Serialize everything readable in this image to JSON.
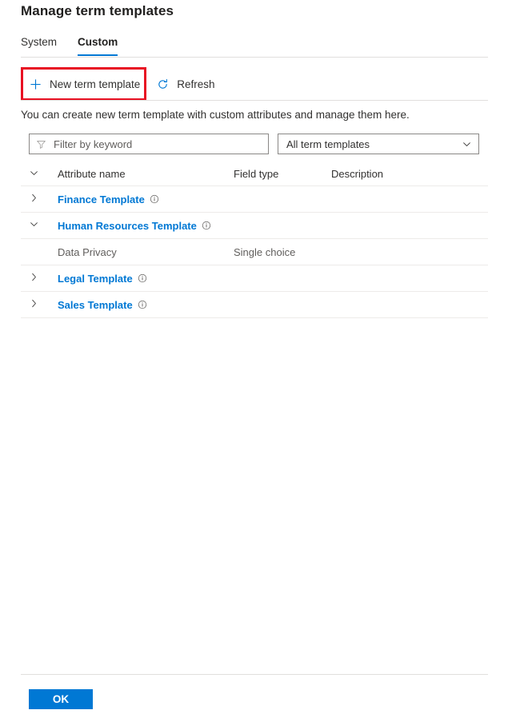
{
  "page": {
    "title": "Manage term templates"
  },
  "tabs": [
    {
      "label": "System",
      "active": false
    },
    {
      "label": "Custom",
      "active": true
    }
  ],
  "toolbar": {
    "new_template_label": "New term template",
    "new_template_icon": "plus-icon",
    "refresh_label": "Refresh",
    "refresh_icon": "refresh-icon",
    "highlight_color": "#e81123"
  },
  "description": "You can create new term template with custom attributes and manage them here.",
  "filters": {
    "search_placeholder": "Filter by keyword",
    "search_value": "",
    "search_icon": "filter-funnel-icon",
    "template_select_value": "All term templates",
    "template_select_icon": "chevron-down-icon"
  },
  "table": {
    "columns": {
      "toggle": "",
      "attribute_name": "Attribute name",
      "field_type": "Field type",
      "description": "Description"
    },
    "header_toggle_icon": "chevron-down-icon",
    "rows": [
      {
        "kind": "template",
        "toggle_icon": "chevron-right-icon",
        "name": "Finance Template",
        "info_icon": "info-icon",
        "field_type": "",
        "description": ""
      },
      {
        "kind": "template",
        "toggle_icon": "chevron-down-icon",
        "name": "Human Resources Template",
        "info_icon": "info-icon",
        "field_type": "",
        "description": ""
      },
      {
        "kind": "attribute",
        "toggle_icon": "",
        "name": "Data Privacy",
        "info_icon": "",
        "field_type": "Single choice",
        "description": ""
      },
      {
        "kind": "template",
        "toggle_icon": "chevron-right-icon",
        "name": "Legal Template",
        "info_icon": "info-icon",
        "field_type": "",
        "description": ""
      },
      {
        "kind": "template",
        "toggle_icon": "chevron-right-icon",
        "name": "Sales Template",
        "info_icon": "info-icon",
        "field_type": "",
        "description": ""
      }
    ]
  },
  "footer": {
    "ok_label": "OK",
    "ok_color": "#0078d4"
  }
}
